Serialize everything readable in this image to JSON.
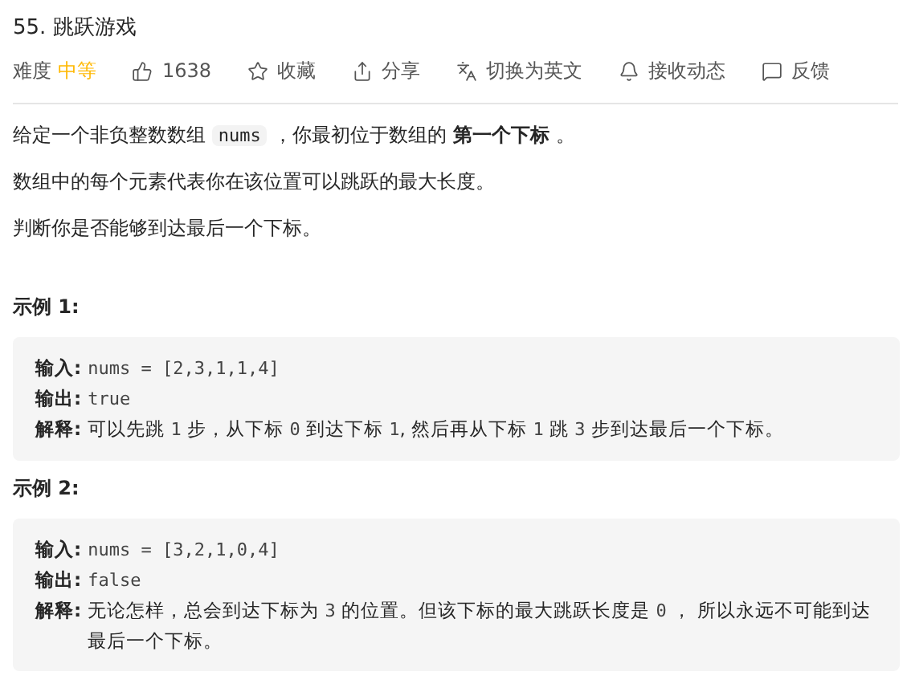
{
  "title": "55. 跳跃游戏",
  "meta": {
    "difficulty_label": "难度",
    "difficulty": "中等",
    "actions": [
      {
        "kind": "like",
        "label": "1638"
      },
      {
        "kind": "star",
        "label": "收藏"
      },
      {
        "kind": "share",
        "label": "分享"
      },
      {
        "kind": "translate",
        "label": "切换为英文"
      },
      {
        "kind": "bell",
        "label": "接收动态"
      },
      {
        "kind": "feedback",
        "label": "反馈"
      }
    ]
  },
  "description": [
    [
      {
        "kind": "text",
        "text": "给定一个非负整数数组 "
      },
      {
        "kind": "code",
        "text": "nums"
      },
      {
        "kind": "text",
        "text": " ，你最初位于数组的 "
      },
      {
        "kind": "bold",
        "text": "第一个下标"
      },
      {
        "kind": "text",
        "text": " 。"
      }
    ],
    [
      {
        "kind": "text",
        "text": "数组中的每个元素代表你在该位置可以跳跃的最大长度。"
      }
    ],
    [
      {
        "kind": "text",
        "text": "判断你是否能够到达最后一个下标。"
      }
    ]
  ],
  "examples": [
    {
      "heading": "示例 1:",
      "lines": [
        {
          "label": "输入:",
          "parts": [
            {
              "kind": "mono",
              "text": "nums = [2,3,1,1,4]"
            }
          ]
        },
        {
          "label": "输出:",
          "parts": [
            {
              "kind": "mono",
              "text": "true"
            }
          ]
        },
        {
          "label": "解释:",
          "parts": [
            {
              "kind": "text",
              "text": "可以先跳 "
            },
            {
              "kind": "mono",
              "text": "1"
            },
            {
              "kind": "text",
              "text": " 步，从下标 "
            },
            {
              "kind": "mono",
              "text": "0"
            },
            {
              "kind": "text",
              "text": " 到达下标 "
            },
            {
              "kind": "mono",
              "text": "1"
            },
            {
              "kind": "text",
              "text": ", 然后再从下标 "
            },
            {
              "kind": "mono",
              "text": "1"
            },
            {
              "kind": "text",
              "text": " 跳 "
            },
            {
              "kind": "mono",
              "text": "3"
            },
            {
              "kind": "text",
              "text": " 步到达最后一个下标。"
            }
          ]
        }
      ]
    },
    {
      "heading": "示例 2:",
      "lines": [
        {
          "label": "输入:",
          "parts": [
            {
              "kind": "mono",
              "text": "nums = [3,2,1,0,4]"
            }
          ]
        },
        {
          "label": "输出:",
          "parts": [
            {
              "kind": "mono",
              "text": "false"
            }
          ]
        },
        {
          "label": "解释:",
          "parts": [
            {
              "kind": "text",
              "text": "无论怎样，总会到达下标为 "
            },
            {
              "kind": "mono",
              "text": "3"
            },
            {
              "kind": "text",
              "text": " 的位置。但该下标的最大跳跃长度是 "
            },
            {
              "kind": "mono",
              "text": "0"
            },
            {
              "kind": "text",
              "text": " ， 所以永远不可能到达最后一个下标。"
            }
          ]
        }
      ]
    }
  ]
}
